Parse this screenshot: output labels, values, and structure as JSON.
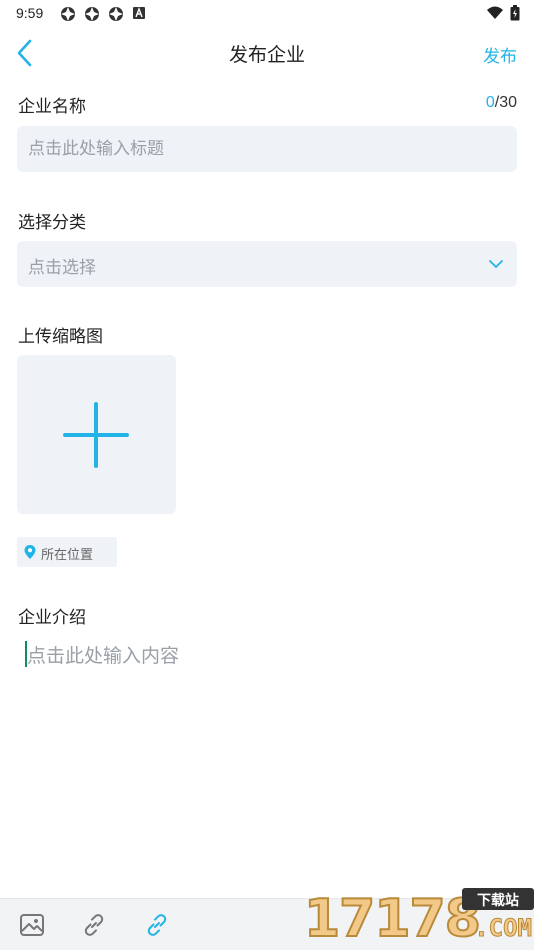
{
  "status_bar": {
    "time": "9:59",
    "left_icons": [
      "notification-icon",
      "notification-icon",
      "notification-icon",
      "a-badge-icon"
    ],
    "right_icons": [
      "wifi-icon",
      "battery-icon"
    ]
  },
  "header": {
    "title": "发布企业",
    "publish_label": "发布",
    "back_icon": "chevron-left-icon"
  },
  "form": {
    "company_name": {
      "label": "企业名称",
      "counter_current": "0",
      "counter_max": "/30",
      "placeholder": "点击此处输入标题",
      "value": ""
    },
    "category": {
      "label": "选择分类",
      "placeholder": "点击选择",
      "icon": "chevron-down-icon"
    },
    "thumbnail": {
      "label": "上传缩略图",
      "icon": "plus-icon"
    },
    "location": {
      "text": "所在位置",
      "icon": "location-pin-icon"
    },
    "intro": {
      "label": "企业介绍",
      "placeholder": "点击此处输入内容"
    }
  },
  "toolbar": {
    "tools": [
      "image-icon",
      "link-icon",
      "link-active-icon"
    ]
  },
  "watermark": {
    "number": "17178",
    "badge": "下载站",
    "suffix": ".COM"
  },
  "colors": {
    "accent": "#22b4e6",
    "field_bg": "#eff2f6",
    "placeholder": "#9aa0a8",
    "toolbar_bg": "#f2f3f5"
  }
}
